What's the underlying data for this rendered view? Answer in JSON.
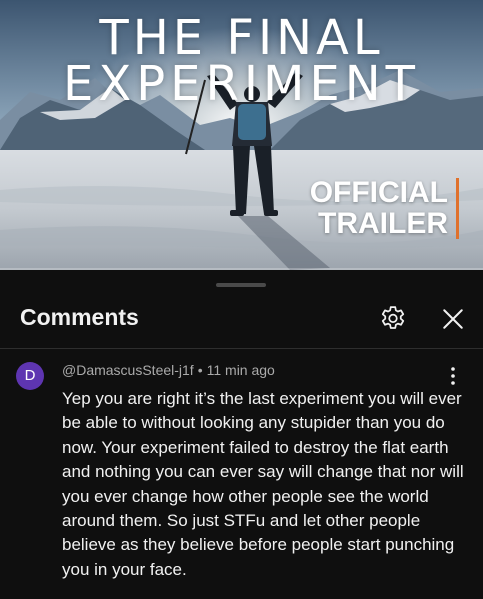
{
  "video": {
    "title_line1": "THE FINAL",
    "title_line2": "EXPERIMENT",
    "badge_line1": "OFFICIAL",
    "badge_line2": "TRAILER",
    "accent_color": "#e0712c"
  },
  "comments_panel": {
    "title": "Comments",
    "settings_icon": "gear-icon",
    "close_icon": "close-icon",
    "comment": {
      "avatar_letter": "D",
      "avatar_color": "#5e35b1",
      "author": "@DamascusSteel-j1f",
      "separator": "•",
      "time": "11 min ago",
      "more_icon": "more-vert-icon",
      "text": "Yep you are right it’s the last experiment you will ever be able to without looking any stupider than you do now. Your experiment failed to destroy the flat earth and nothing you can ever say will change that nor will you ever change how other people see the world around them.  So just STFu and let other people believe as they believe before people start punching you in your face."
    }
  }
}
